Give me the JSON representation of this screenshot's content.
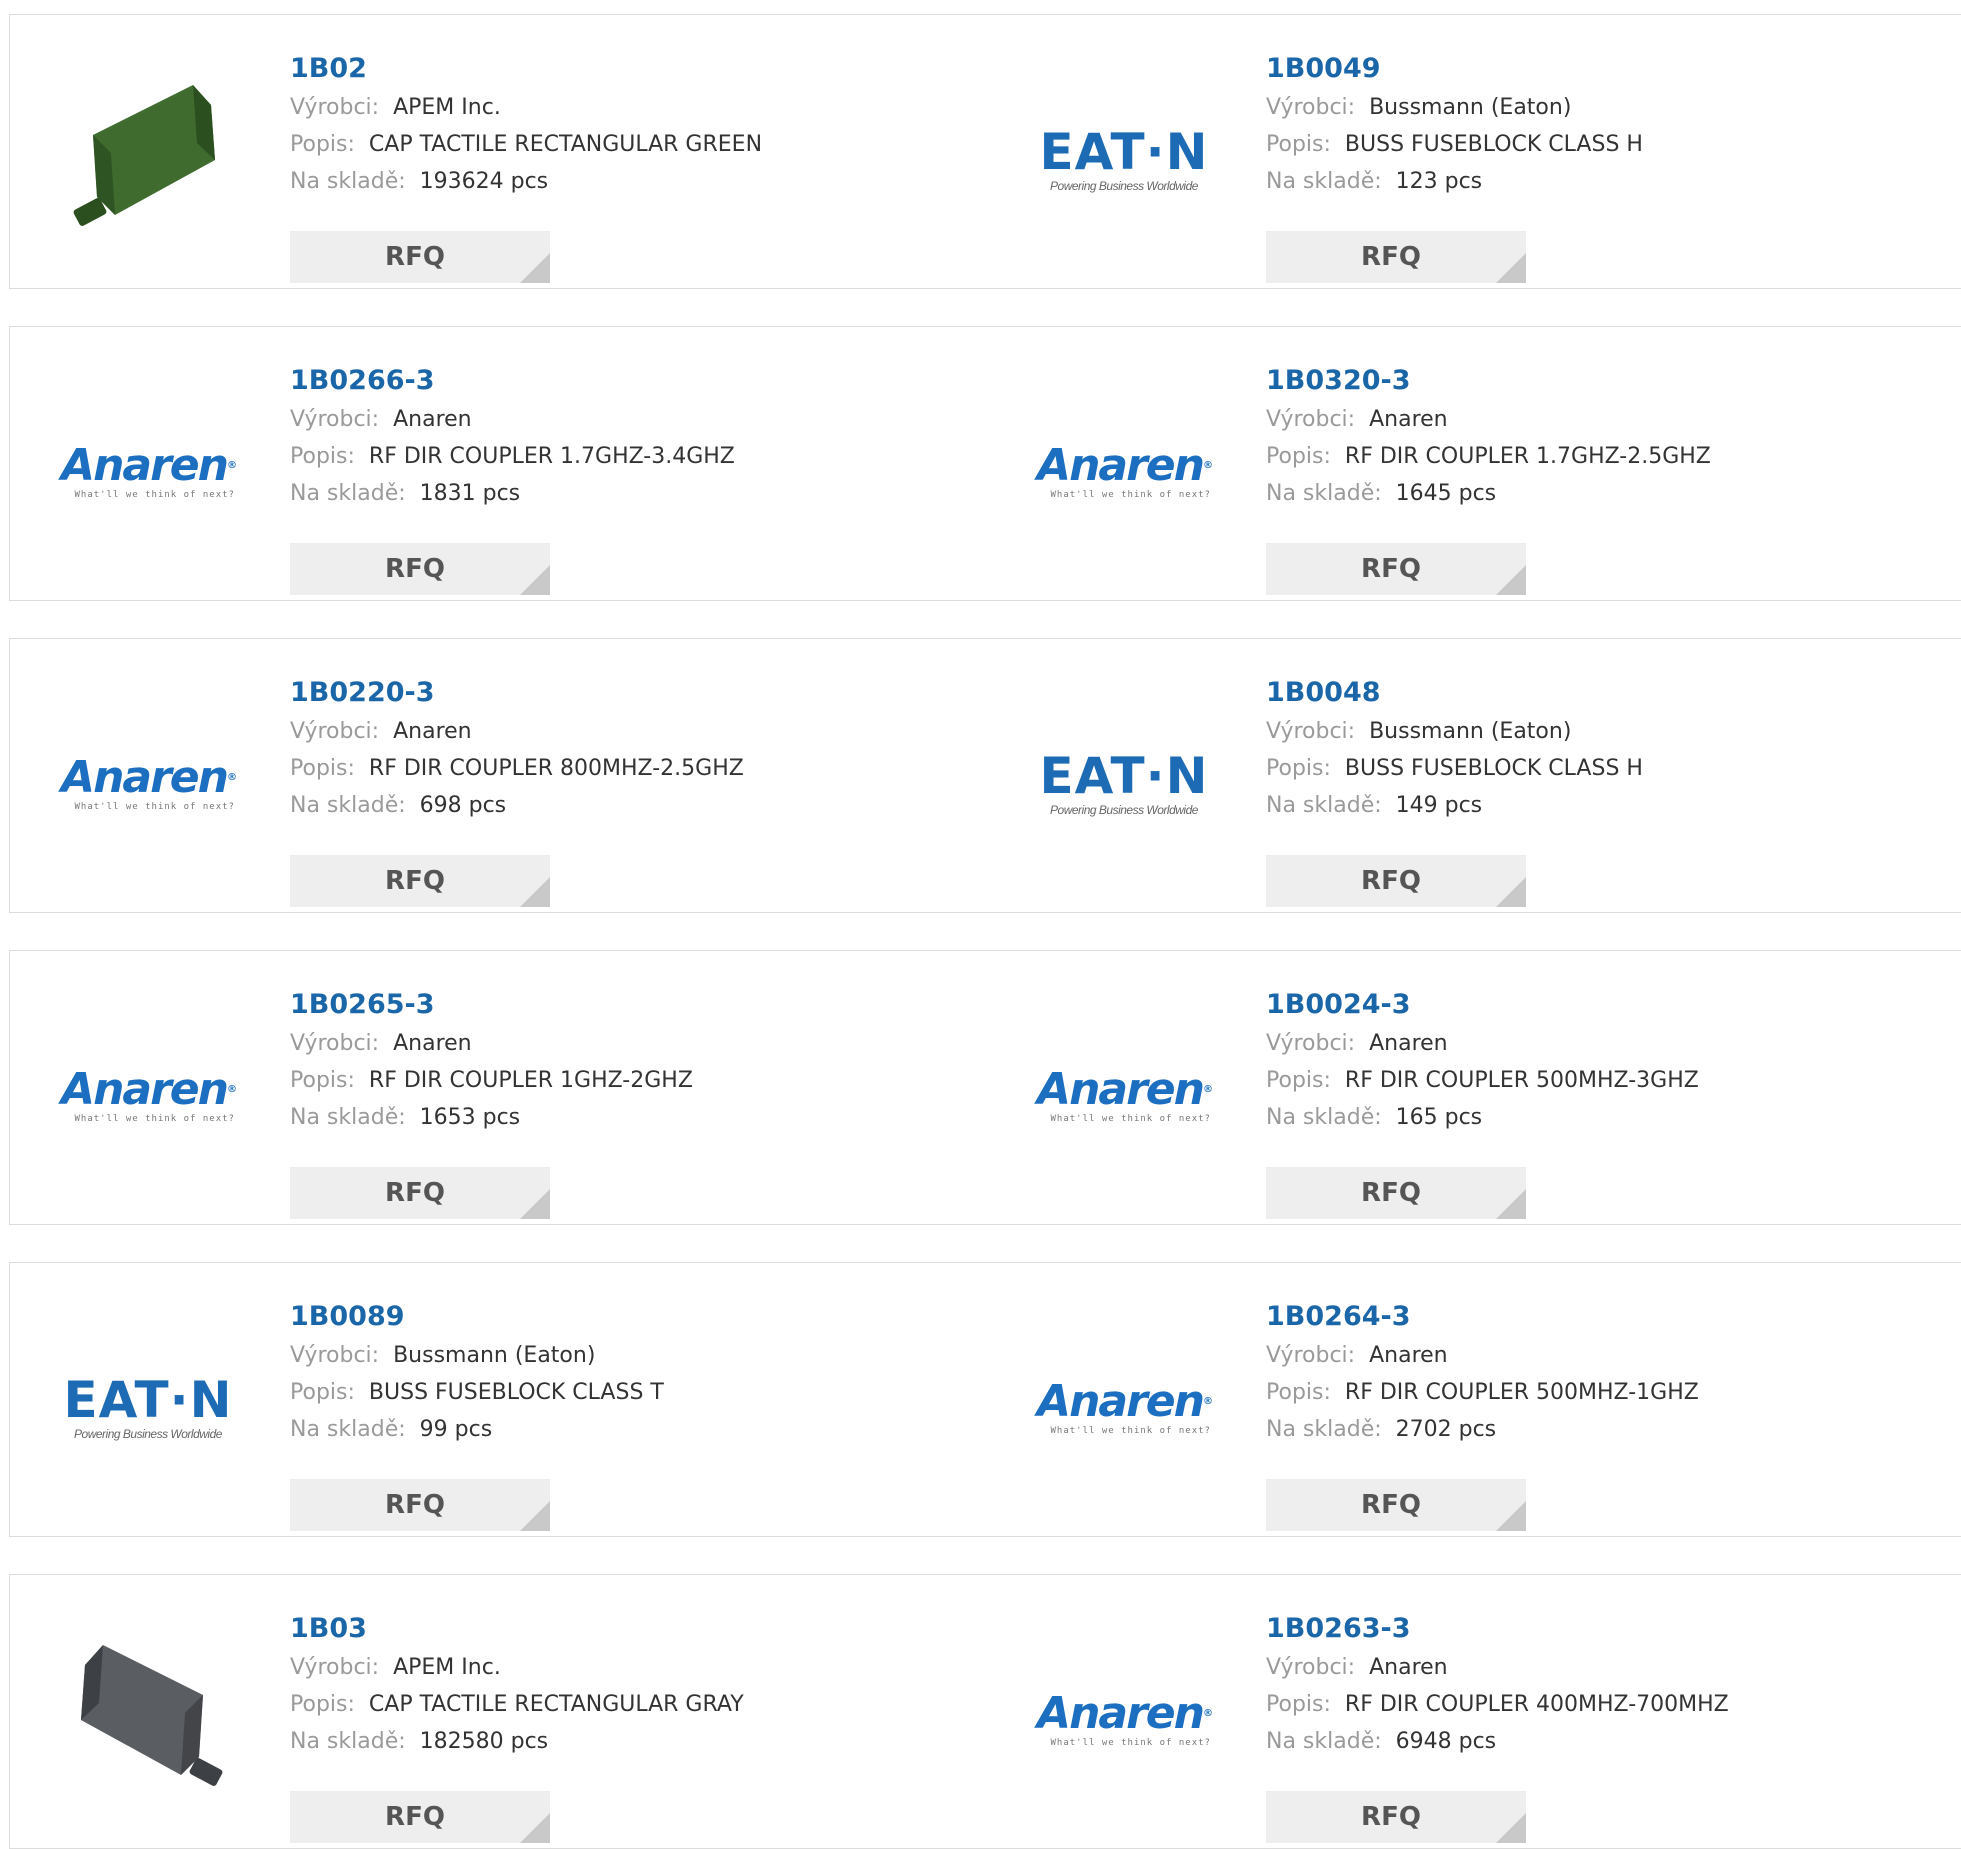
{
  "labels": {
    "manufacturer": "Výrobci:",
    "description": "Popis:",
    "stock": "Na skladě:",
    "rfq": "RFQ"
  },
  "colors": {
    "part_link": "#1a66a8",
    "anaren_blue": "#1c6fc0",
    "eaton_blue": "#1d6bb5",
    "rfq_bg": "#eeeeee"
  },
  "logo_text": {
    "anaren_word": "Anaren",
    "anaren_tagline": "What'll we think of next?",
    "eaton_word": "EAT·N",
    "eaton_tagline": "Powering Business Worldwide"
  },
  "products": [
    {
      "part": "1B02",
      "manufacturer": "APEM Inc.",
      "description": "CAP TACTILE RECTANGULAR GREEN",
      "stock": "193624 pcs",
      "image": "green-cap"
    },
    {
      "part": "1B0049",
      "manufacturer": "Bussmann (Eaton)",
      "description": "BUSS FUSEBLOCK CLASS H",
      "stock": "123 pcs",
      "image": "eaton-logo"
    },
    {
      "part": "1B0266-3",
      "manufacturer": "Anaren",
      "description": "RF DIR COUPLER 1.7GHZ-3.4GHZ",
      "stock": "1831 pcs",
      "image": "anaren-logo"
    },
    {
      "part": "1B0320-3",
      "manufacturer": "Anaren",
      "description": "RF DIR COUPLER 1.7GHZ-2.5GHZ",
      "stock": "1645 pcs",
      "image": "anaren-logo"
    },
    {
      "part": "1B0220-3",
      "manufacturer": "Anaren",
      "description": "RF DIR COUPLER 800MHZ-2.5GHZ",
      "stock": "698 pcs",
      "image": "anaren-logo"
    },
    {
      "part": "1B0048",
      "manufacturer": "Bussmann (Eaton)",
      "description": "BUSS FUSEBLOCK CLASS H",
      "stock": "149 pcs",
      "image": "eaton-logo"
    },
    {
      "part": "1B0265-3",
      "manufacturer": "Anaren",
      "description": "RF DIR COUPLER 1GHZ-2GHZ",
      "stock": "1653 pcs",
      "image": "anaren-logo"
    },
    {
      "part": "1B0024-3",
      "manufacturer": "Anaren",
      "description": "RF DIR COUPLER 500MHZ-3GHZ",
      "stock": "165 pcs",
      "image": "anaren-logo"
    },
    {
      "part": "1B0089",
      "manufacturer": "Bussmann (Eaton)",
      "description": "BUSS FUSEBLOCK CLASS T",
      "stock": "99 pcs",
      "image": "eaton-logo"
    },
    {
      "part": "1B0264-3",
      "manufacturer": "Anaren",
      "description": "RF DIR COUPLER 500MHZ-1GHZ",
      "stock": "2702 pcs",
      "image": "anaren-logo"
    },
    {
      "part": "1B03",
      "manufacturer": "APEM Inc.",
      "description": "CAP TACTILE RECTANGULAR GRAY",
      "stock": "182580 pcs",
      "image": "gray-cap"
    },
    {
      "part": "1B0263-3",
      "manufacturer": "Anaren",
      "description": "RF DIR COUPLER 400MHZ-700MHZ",
      "stock": "6948 pcs",
      "image": "anaren-logo"
    }
  ]
}
